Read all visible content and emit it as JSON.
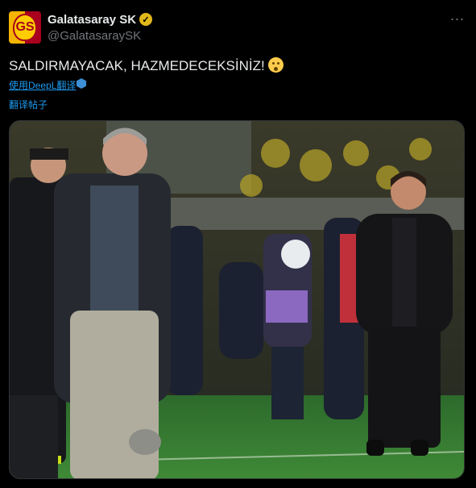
{
  "account": {
    "name": "Galatasaray SK",
    "handle": "@GalatasaraySK",
    "avatar_icon": "galatasaray-crest-icon",
    "verified_icon": "gold-verified-badge-icon",
    "crest_letters": "GS"
  },
  "post": {
    "text": "SALDIRMAYACAK, HAZMEDECEKSİNİZ!",
    "emoji": "hushed-face-emoji"
  },
  "translation": {
    "deepl_link": "使用DeepL翻译",
    "translate_link": "翻译帖子"
  },
  "media": {
    "type": "photo",
    "description_icon": "football-match-sideline-photo"
  },
  "menu": {
    "more_icon": "more-options-icon"
  },
  "colors": {
    "background": "#000000",
    "link": "#1d9bf0",
    "secondary": "#71767b",
    "verified": "#e2b719"
  }
}
